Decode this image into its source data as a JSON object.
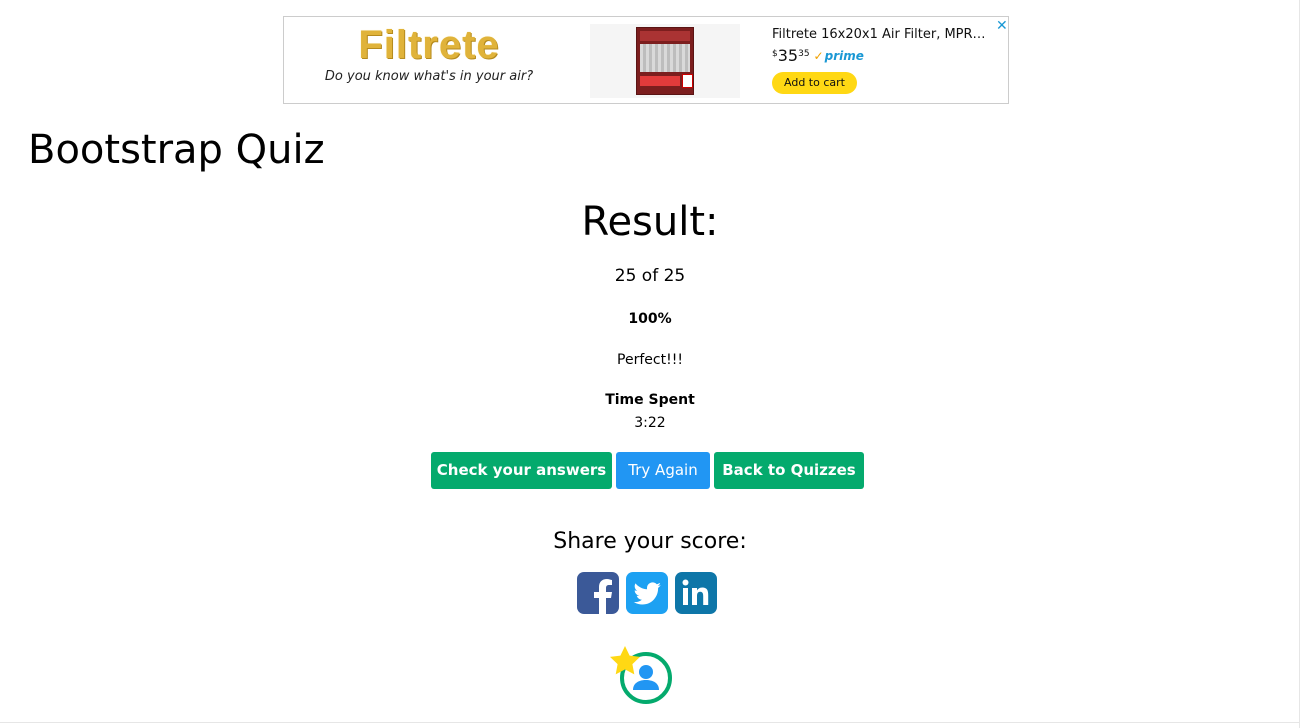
{
  "ad": {
    "brand": "Filtrete",
    "tagline": "Do you know what's in your air?",
    "product_title": "Filtrete 16x20x1 Air Filter, MPR…",
    "price_currency": "$",
    "price_whole": "35",
    "price_fraction": "35",
    "prime_label": "prime",
    "cart_label": "Add to cart",
    "close_glyph": "✕",
    "colors": {
      "logo": "#e0b33a",
      "prime": "#1a98d4",
      "cart": "#ffd814"
    }
  },
  "page": {
    "title": "Bootstrap Quiz"
  },
  "result": {
    "heading": "Result:",
    "score": "25 of 25",
    "percent": "100%",
    "message": "Perfect!!!",
    "time_label": "Time Spent",
    "time_value": "3:22"
  },
  "actions": {
    "check_label": "Check your answers",
    "try_label": "Try Again",
    "back_label": "Back to Quizzes",
    "colors": {
      "green": "#04aa6d",
      "blue": "#2196f3"
    }
  },
  "share": {
    "label": "Share your score:",
    "icons": [
      "facebook-icon",
      "twitter-icon",
      "linkedin-icon"
    ],
    "colors": {
      "facebook": "#3b5998",
      "twitter": "#1da1f2",
      "linkedin": "#0e76a8"
    }
  },
  "profile": {
    "icon": "star-user-icon",
    "colors": {
      "star": "#ffd814",
      "ring": "#04aa6d",
      "user": "#2196f3"
    }
  }
}
